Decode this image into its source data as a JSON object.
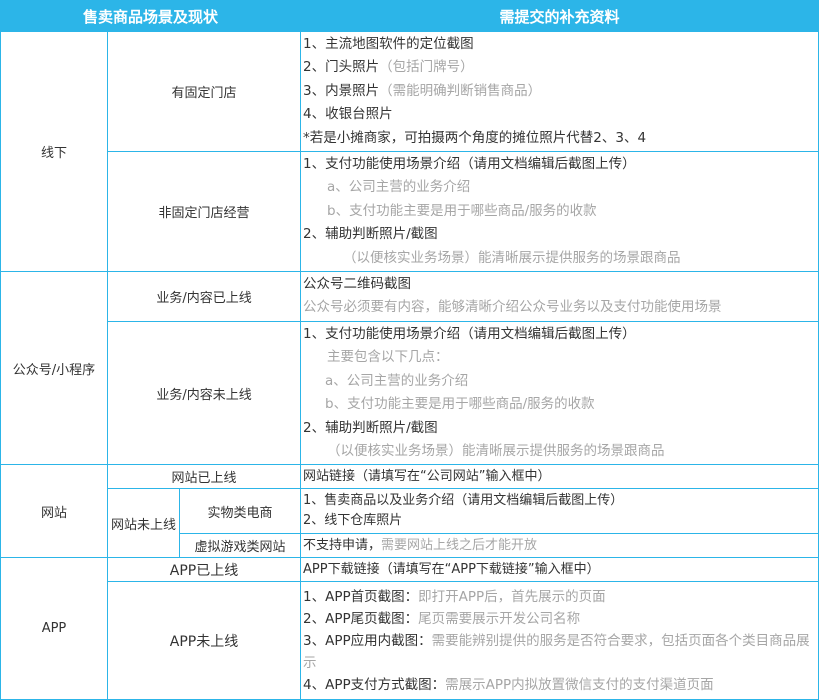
{
  "header": {
    "col_scene": "售卖商品场景及现状",
    "col_materials": "需提交的补充资料"
  },
  "offline": {
    "label": "线下",
    "fixed_store": {
      "label": "有固定门店",
      "lines": [
        {
          "main": "1、主流地图软件的定位截图",
          "note": ""
        },
        {
          "main": "2、门头照片",
          "note": "（包括门牌号）"
        },
        {
          "main": "3、内景照片",
          "note": "（需能明确判断销售商品）"
        },
        {
          "main": "4、收银台照片",
          "note": ""
        },
        {
          "main": "*若是小摊商家，可拍摄两个角度的摊位照片代替2、3、4",
          "note": ""
        }
      ]
    },
    "nonfixed_store": {
      "label": "非固定门店经营",
      "line1": "1、支付功能使用场景介绍（请用文档编辑后截图上传）",
      "line1a": "a、公司主营的业务介绍",
      "line1b": "b、支付功能主要是用于哪些商品/服务的收款",
      "line2": "2、辅助判断照片/截图",
      "line2note": "（以便核实业务场景）能清晰展示提供服务的场景跟商品"
    }
  },
  "official_account": {
    "label": "公众号/小程序",
    "online": {
      "label": "业务/内容已上线",
      "line1": "公众号二维码截图",
      "line2": "公众号必须要有内容，能够清晰介绍公众号业务以及支付功能使用场景"
    },
    "not_online": {
      "label": "业务/内容未上线",
      "line1": "1、支付功能使用场景介绍（请用文档编辑后截图上传）",
      "line1note": "主要包含以下几点：",
      "line1a": "a、公司主营的业务介绍",
      "line1b": "b、支付功能主要是用于哪些商品/服务的收款",
      "line2": "2、辅助判断照片/截图",
      "line2note": "（以便核实业务场景）能清晰展示提供服务的场景跟商品"
    }
  },
  "website": {
    "label": "网站",
    "online": {
      "label": "网站已上线",
      "line1": "网站链接（请填写在“公司网站”输入框中）"
    },
    "not_online": {
      "label": "网站未上线",
      "physical": {
        "label": "实物类电商",
        "line1": "1、售卖商品以及业务介绍（请用文档编辑后截图上传）",
        "line2": "2、线下仓库照片"
      },
      "virtual": {
        "label": "虚拟游戏类网站",
        "main": "不支持申请，",
        "note": "需要网站上线之后才能开放"
      }
    }
  },
  "app": {
    "label": "APP",
    "online": {
      "label": "APP已上线",
      "line1": "APP下载链接（请填写在“APP下载链接”输入框中）"
    },
    "not_online": {
      "label": "APP未上线",
      "items": [
        {
          "main": "1、APP首页截图：",
          "note": "即打开APP后，首先展示的页面"
        },
        {
          "main": "2、APP尾页截图：",
          "note": "尾页需要展示开发公司名称"
        },
        {
          "main": "3、APP应用内截图：",
          "note": "需要能辨别提供的服务是否符合要求，包括页面各个类目商品展示"
        },
        {
          "main": "4、APP支付方式截图：",
          "note": "需展示APP内拟放置微信支付的支付渠道页面"
        }
      ]
    }
  },
  "colors": {
    "accent": "#2cb5e8",
    "text": "#333333",
    "note": "#a6a6a6"
  }
}
